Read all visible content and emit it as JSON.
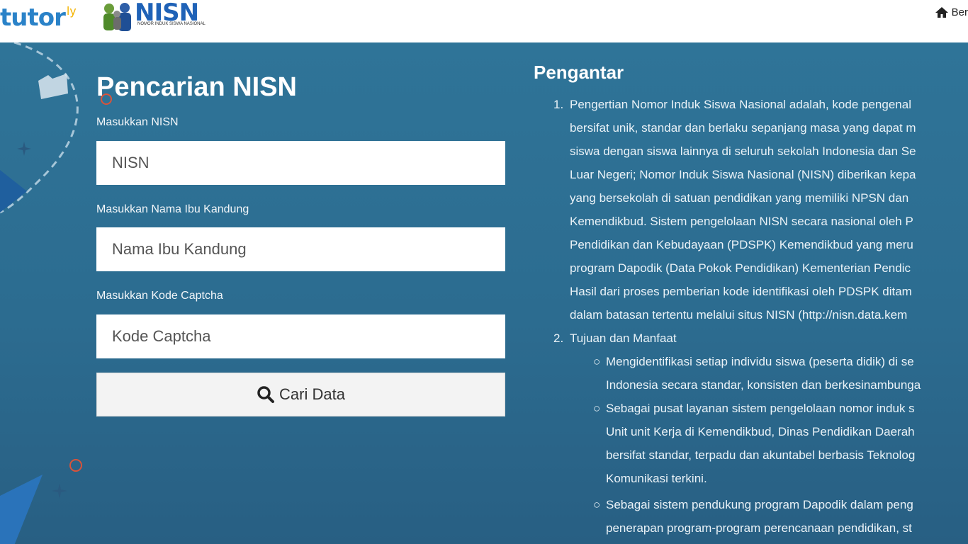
{
  "header": {
    "brand_main": "tutor",
    "brand_suffix": "ly",
    "logo_title": "NISN",
    "logo_subtitle": "NOMOR INDUK SISWA NASIONAL",
    "home_label": "Ber"
  },
  "search_form": {
    "title": "Pencarian NISN",
    "nisn_label": "Masukkan NISN",
    "nisn_placeholder": "NISN",
    "mother_label": "Masukkan Nama Ibu Kandung",
    "mother_placeholder": "Nama Ibu Kandung",
    "captcha_label": "Masukkan Kode Captcha",
    "captcha_placeholder": "Kode Captcha",
    "submit_label": "Cari Data"
  },
  "intro": {
    "title": "Pengantar",
    "item1_number": "1.",
    "item1_lines": [
      "Pengertian Nomor Induk Siswa Nasional adalah, kode pengenal",
      "bersifat unik, standar dan berlaku sepanjang masa yang dapat m",
      "siswa dengan siswa lainnya di seluruh sekolah Indonesia dan Se",
      "Luar Negeri; Nomor Induk Siswa Nasional (NISN) diberikan kepa",
      "yang bersekolah di satuan pendidikan yang memiliki NPSN dan",
      "Kemendikbud. Sistem pengelolaan NISN secara nasional oleh P",
      "Pendidikan dan Kebudayaan (PDSPK) Kemendikbud yang meru",
      "program Dapodik (Data Pokok Pendidikan) Kementerian Pendic",
      "Hasil dari proses pemberian kode identifikasi oleh PDSPK ditam",
      "dalam batasan tertentu melalui situs NISN (http://nisn.data.kem"
    ],
    "item2_number": "2.",
    "item2_title": "Tujuan dan Manfaat",
    "bullet1_lines": [
      "Mengidentifikasi setiap individu siswa (peserta didik) di se",
      "Indonesia secara standar, konsisten dan berkesinambunga"
    ],
    "bullet2_lines": [
      "Sebagai pusat layanan sistem pengelolaan nomor induk s",
      "Unit unit Kerja di Kemendikbud, Dinas Pendidikan Daerah",
      "bersifat standar, terpadu dan akuntabel berbasis Teknolog",
      "Komunikasi terkini."
    ],
    "bullet3_lines": [
      "Sebagai sistem pendukung program Dapodik dalam peng",
      "penerapan program-program perencanaan pendidikan, st"
    ]
  }
}
